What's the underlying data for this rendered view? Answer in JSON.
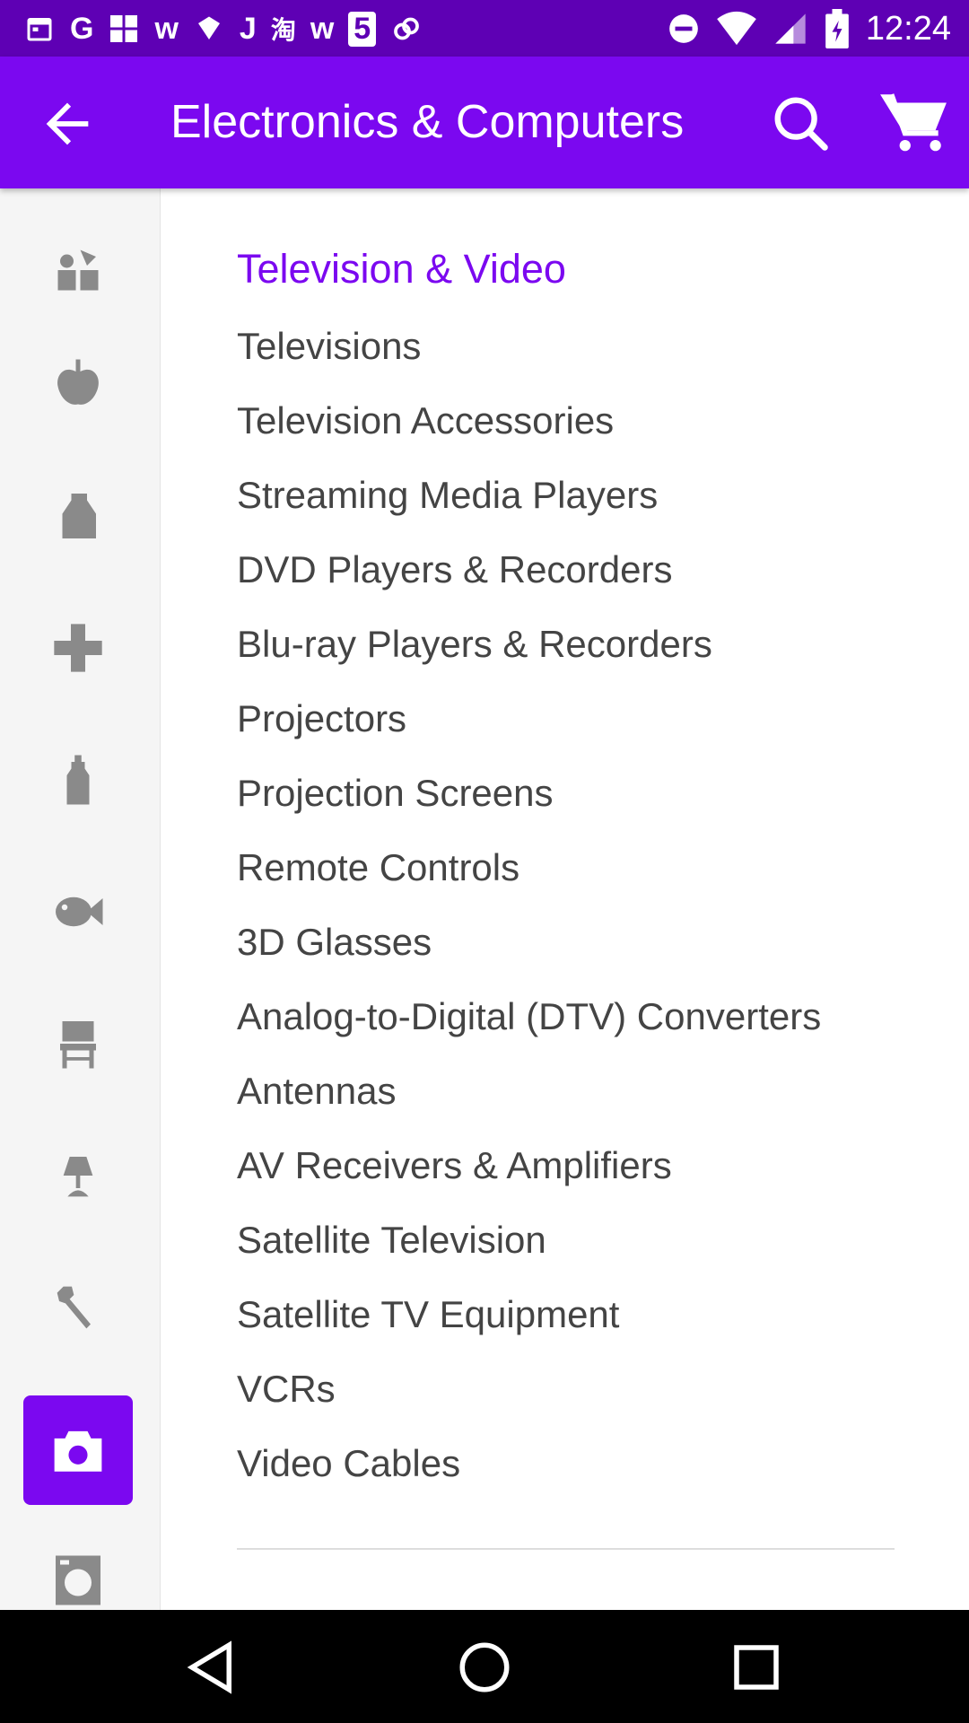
{
  "status_bar": {
    "time": "12:24",
    "notification_glyphs": [
      "G",
      "w",
      "J",
      "淘",
      "w",
      "5"
    ]
  },
  "app_bar": {
    "title": "Electronics & Computers",
    "background_color": "#7b08f0"
  },
  "sidebar": {
    "items": [
      {
        "icon": "toys-icon",
        "active": false
      },
      {
        "icon": "apple-icon",
        "active": false
      },
      {
        "icon": "detergent-bottle-icon",
        "active": false
      },
      {
        "icon": "health-cross-icon",
        "active": false
      },
      {
        "icon": "baby-bottle-icon",
        "active": false
      },
      {
        "icon": "fish-icon",
        "active": false
      },
      {
        "icon": "chair-icon",
        "active": false
      },
      {
        "icon": "lamp-icon",
        "active": false
      },
      {
        "icon": "wrench-icon",
        "active": false
      },
      {
        "icon": "camera-icon",
        "active": true
      },
      {
        "icon": "washing-machine-icon",
        "active": false
      }
    ]
  },
  "content": {
    "section_title": "Television & Video",
    "categories": [
      "Televisions",
      "Television Accessories",
      "Streaming Media Players",
      "DVD Players & Recorders",
      "Blu-ray Players & Recorders",
      "Projectors",
      "Projection Screens",
      "Remote Controls",
      "3D Glasses",
      "Analog-to-Digital (DTV) Converters",
      "Antennas",
      "AV Receivers & Amplifiers",
      "Satellite Television",
      "Satellite TV Equipment",
      "VCRs",
      "Video Cables"
    ]
  },
  "colors": {
    "accent": "#7b08f0",
    "status_bar": "#5e00b4",
    "text": "#444444",
    "sidebar_icon": "#8a8a8a"
  }
}
